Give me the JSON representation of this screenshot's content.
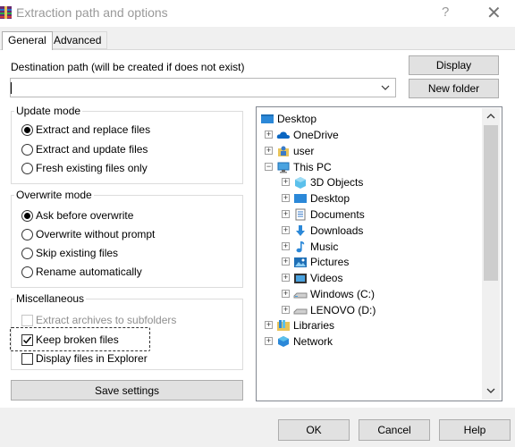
{
  "window": {
    "title": "Extraction path and options",
    "help_glyph": "?",
    "close_glyph": "✕"
  },
  "tabs": [
    {
      "label": "General",
      "active": true
    },
    {
      "label": "Advanced",
      "active": false
    }
  ],
  "destination": {
    "label": "Destination path (will be created if does not exist)",
    "value": "",
    "display_button": "Display",
    "new_folder_button": "New folder"
  },
  "update_mode": {
    "title": "Update mode",
    "options": [
      {
        "label": "Extract and replace files",
        "selected": true
      },
      {
        "label": "Extract and update files",
        "selected": false
      },
      {
        "label": "Fresh existing files only",
        "selected": false
      }
    ]
  },
  "overwrite_mode": {
    "title": "Overwrite mode",
    "options": [
      {
        "label": "Ask before overwrite",
        "selected": true
      },
      {
        "label": "Overwrite without prompt",
        "selected": false
      },
      {
        "label": "Skip existing files",
        "selected": false
      },
      {
        "label": "Rename automatically",
        "selected": false
      }
    ]
  },
  "misc": {
    "title": "Miscellaneous",
    "options": [
      {
        "label": "Extract archives to subfolders",
        "checked": false,
        "disabled": true
      },
      {
        "label": "Keep broken files",
        "checked": true,
        "disabled": false
      },
      {
        "label": "Display files in Explorer",
        "checked": false,
        "disabled": false
      }
    ]
  },
  "save_settings": "Save settings",
  "tree": {
    "items": [
      {
        "label": "Desktop",
        "icon": "desktop-icon"
      },
      {
        "label": "OneDrive",
        "icon": "cloud-icon"
      },
      {
        "label": "user",
        "icon": "user-folder-icon"
      },
      {
        "label": "This PC",
        "icon": "computer-icon"
      },
      {
        "label": "3D Objects",
        "icon": "3d-objects-icon"
      },
      {
        "label": "Desktop",
        "icon": "desktop-icon"
      },
      {
        "label": "Documents",
        "icon": "documents-icon"
      },
      {
        "label": "Downloads",
        "icon": "downloads-icon"
      },
      {
        "label": "Music",
        "icon": "music-icon"
      },
      {
        "label": "Pictures",
        "icon": "pictures-icon"
      },
      {
        "label": "Videos",
        "icon": "videos-icon"
      },
      {
        "label": "Windows (C:)",
        "icon": "drive-icon"
      },
      {
        "label": "LENOVO (D:)",
        "icon": "drive-icon"
      },
      {
        "label": "Libraries",
        "icon": "libraries-icon"
      },
      {
        "label": "Network",
        "icon": "network-icon"
      }
    ]
  },
  "footer": {
    "ok": "OK",
    "cancel": "Cancel",
    "help": "Help"
  }
}
